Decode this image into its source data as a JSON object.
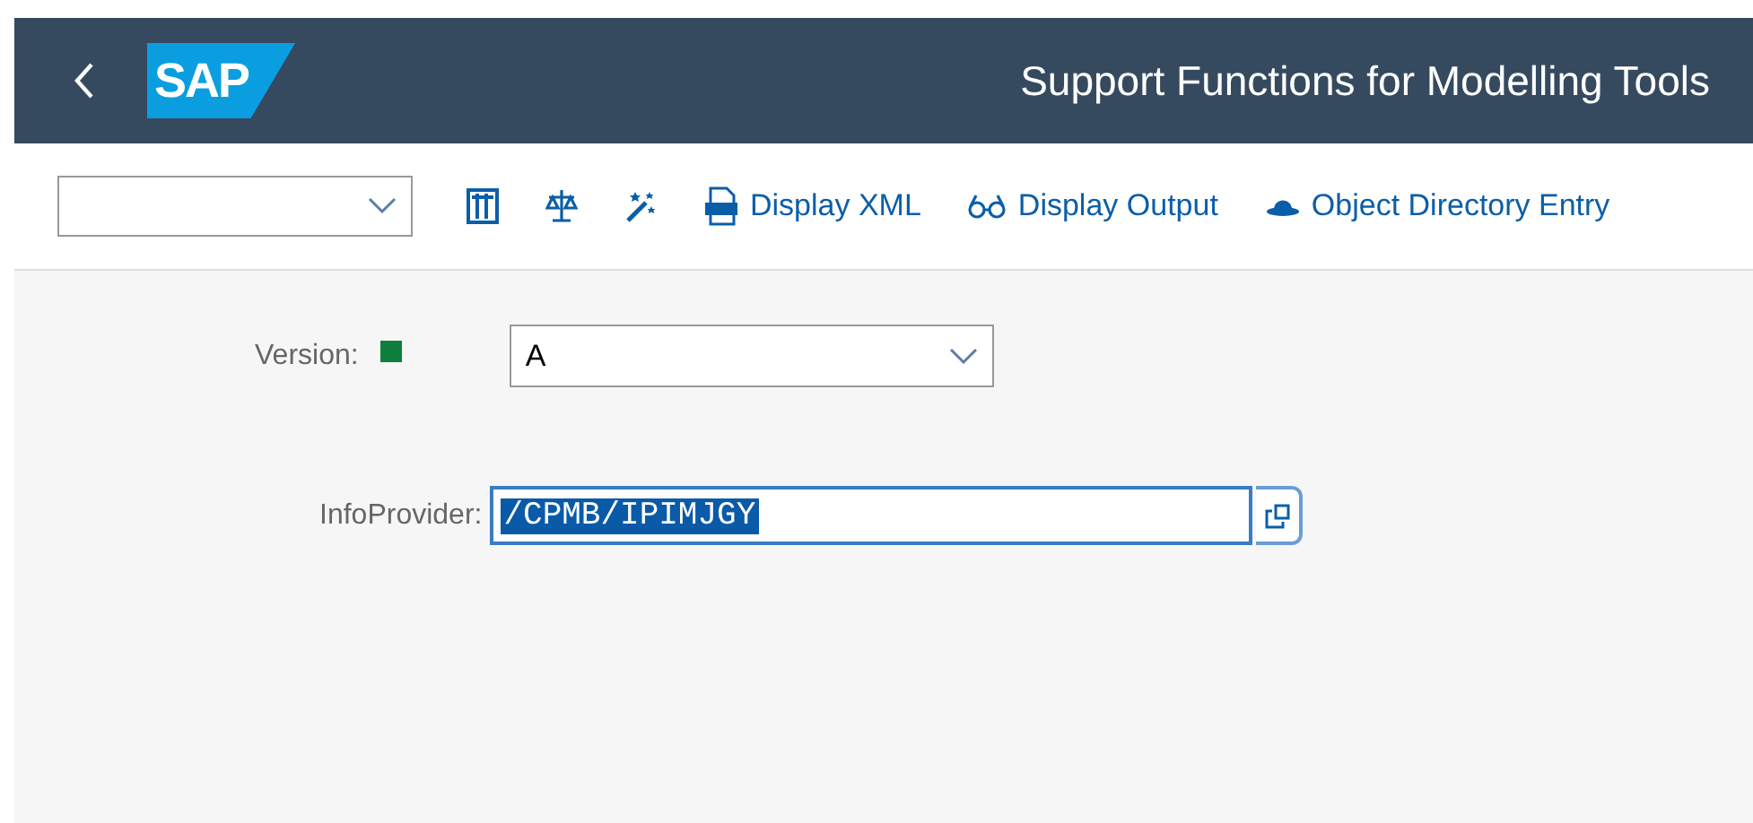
{
  "header": {
    "logo": "SAP",
    "title": "Support Functions for Modelling Tools"
  },
  "toolbar": {
    "buttons": [
      {
        "kind": "columns"
      },
      {
        "kind": "scales"
      },
      {
        "kind": "wand"
      },
      {
        "kind": "xml",
        "label": "Display XML"
      },
      {
        "kind": "glasses",
        "label": "Display Output"
      },
      {
        "kind": "hat",
        "label": "Object Directory Entry"
      }
    ]
  },
  "form": {
    "version": {
      "label": "Version:",
      "color": "#0e7f3e",
      "value": "A"
    },
    "infoprovider": {
      "label": "InfoProvider:",
      "value": "/CPMB/IPIMJGY",
      "selected": true
    }
  }
}
